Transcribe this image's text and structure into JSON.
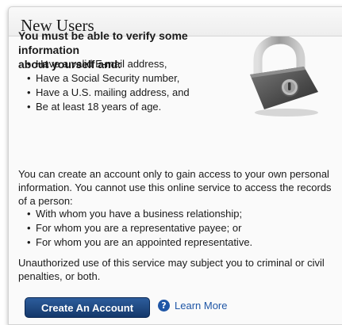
{
  "panel": {
    "title": "New Users",
    "intro_line1": "You must be able to verify some information",
    "intro_line2": "about yourself and:",
    "requirements": [
      "Have a valid E-mail address,",
      "Have a Social Security number,",
      "Have a U.S. mailing address, and",
      "Be at least 18 years of age."
    ],
    "paragraph1": "You can create an account only to gain access to your own personal information. You cannot use this online service to access the records of a person:",
    "restrictions": [
      "With whom you have a business relationship;",
      "For whom you are a representative payee; or",
      "For whom you are an appointed representative."
    ],
    "paragraph2": "Unauthorized use of this service may subject you to criminal or civil penalties, or both.",
    "create_button_label": "Create An Account",
    "help_icon_glyph": "?",
    "learn_more_label": "Learn More"
  },
  "icons": {
    "lock": "padlock-icon",
    "help": "question-circle-icon"
  },
  "colors": {
    "button": "#1f4a82",
    "link": "#1f56a6",
    "panel_background": "#f4f4f4"
  }
}
